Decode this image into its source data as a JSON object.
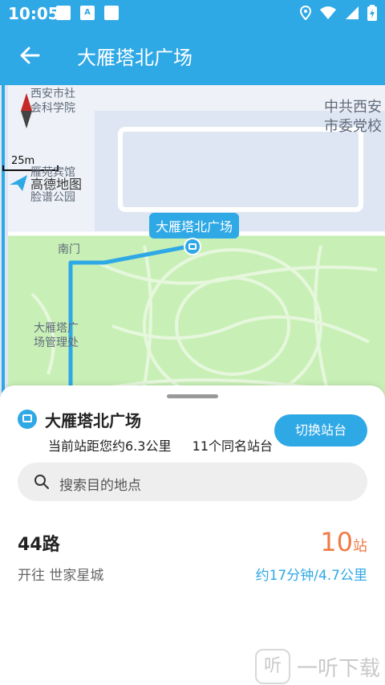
{
  "status_bar": {
    "time": "10:05",
    "notification_letter": "A"
  },
  "app_bar": {
    "title": "大雁塔北广场"
  },
  "map": {
    "labels": {
      "academy": "西安市社\n会科学院",
      "hotel": "雁苑宾馆",
      "park": "脸谱公园",
      "party": "中共西安\n市委党校",
      "south_gate": "南门",
      "square_office": "大雁塔广\n场管理处"
    },
    "scale": "25m",
    "logo": "高德地图",
    "station_bubble": "大雁塔北广场",
    "colors": {
      "park_green": "#c8f0b6",
      "route_blue": "#2fa8e6",
      "block": "#dfe6f3"
    }
  },
  "stop_card": {
    "name": "大雁塔北广场",
    "distance_text": "当前站距您约6.3公里",
    "same_name_text": "11个同名站台",
    "switch_button": "切换站台"
  },
  "search": {
    "placeholder": "搜索目的地点"
  },
  "route": {
    "number": "44路",
    "direction": "开往  世家星城",
    "stops_count": "10",
    "stops_unit": "站",
    "eta": "约17分钟/4.7公里"
  },
  "watermark": {
    "icon_text": "听",
    "text": "一听下载"
  },
  "theme": {
    "primary": "#2fa8e6",
    "accent": "#f07a45"
  }
}
